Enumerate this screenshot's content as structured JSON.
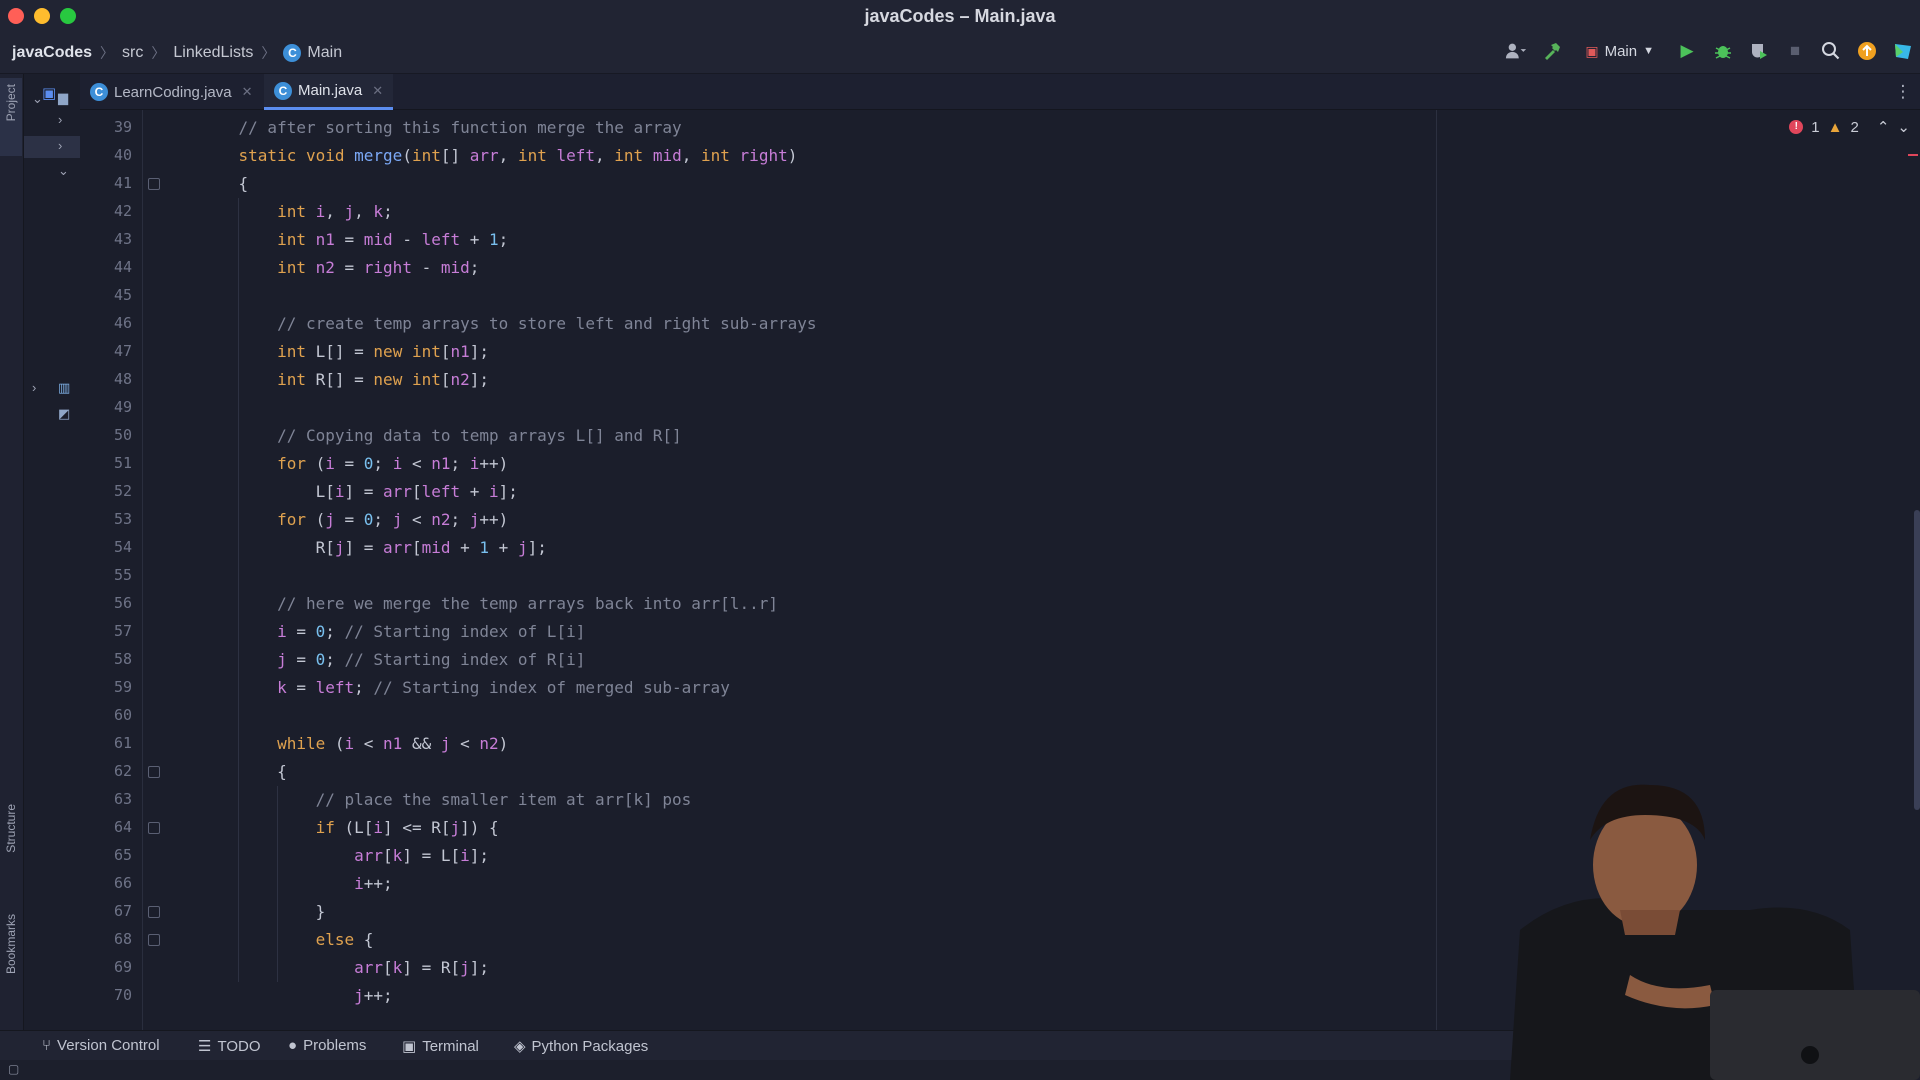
{
  "window": {
    "title": "javaCodes – Main.java"
  },
  "breadcrumb": {
    "project": "javaCodes",
    "folder": "src",
    "package": "LinkedLists",
    "file": "Main"
  },
  "toolbar": {
    "run_config": "Main"
  },
  "tabs": [
    {
      "label": "LearnCoding.java"
    },
    {
      "label": "Main.java"
    }
  ],
  "inspections": {
    "errors": "1",
    "warnings": "2"
  },
  "left_strip": {
    "project": "Project",
    "structure": "Structure",
    "bookmarks": "Bookmarks"
  },
  "bottom_tools": {
    "version_control": "Version Control",
    "todo": "TODO",
    "problems": "Problems",
    "terminal": "Terminal",
    "python_packages": "Python Packages"
  },
  "code": {
    "first_line": 39,
    "lines": [
      "    // after sorting this function merge the array",
      "    static void merge(int[] arr, int left, int mid, int right)",
      "    {",
      "        int i, j, k;",
      "        int n1 = mid - left + 1;",
      "        int n2 = right - mid;",
      "",
      "        // create temp arrays to store left and right sub-arrays",
      "        int L[] = new int[n1];",
      "        int R[] = new int[n2];",
      "",
      "        // Copying data to temp arrays L[] and R[]",
      "        for (i = 0; i < n1; i++)",
      "            L[i] = arr[left + i];",
      "        for (j = 0; j < n2; j++)",
      "            R[j] = arr[mid + 1 + j];",
      "",
      "        // here we merge the temp arrays back into arr[l..r]",
      "        i = 0; // Starting index of L[i]",
      "        j = 0; // Starting index of R[i]",
      "        k = left; // Starting index of merged sub-array",
      "",
      "        while (i < n1 && j < n2)",
      "        {",
      "            // place the smaller item at arr[k] pos",
      "            if (L[i] <= R[j]) {",
      "                arr[k] = L[i];",
      "                i++;",
      "            }",
      "            else {",
      "                arr[k] = R[j];",
      "                j++;"
    ]
  }
}
